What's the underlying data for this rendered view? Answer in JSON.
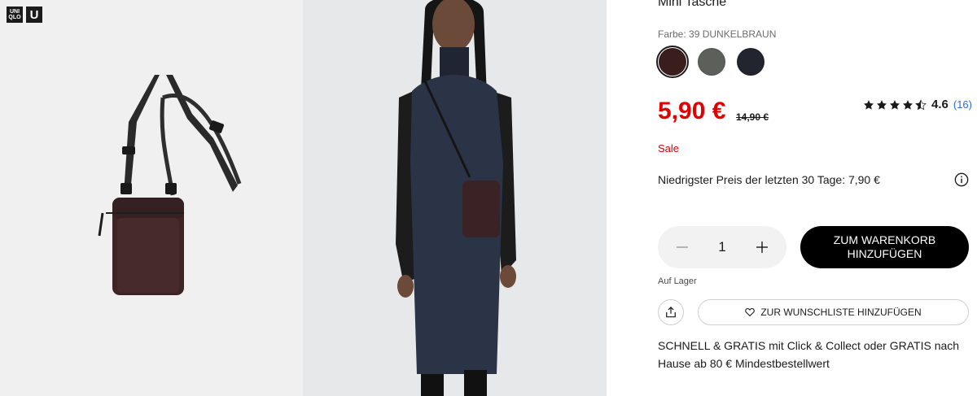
{
  "logo": {
    "uniqlo_lines": [
      "UNI",
      "QLO"
    ],
    "u": "U"
  },
  "product": {
    "title": "Mini Tasche",
    "color_label": "Farbe: 39 DUNKELBRAUN",
    "swatches": [
      {
        "name": "DUNKELBRAUN",
        "color": "#3a1e1d",
        "selected": true
      },
      {
        "name": "OLIVE",
        "color": "#5c5f5a",
        "selected": false
      },
      {
        "name": "NAVY",
        "color": "#22252d",
        "selected": false
      }
    ],
    "price": "5,90 €",
    "old_price": "14,90 €",
    "price_color": "#e00000",
    "rating": {
      "value": "4.6",
      "count": "(16)",
      "stars": 4.5
    },
    "sale_label": "Sale",
    "lowest_price": "Niedrigster Preis der letzten 30 Tage: 7,90 €",
    "quantity": "1",
    "add_to_cart": "ZUM WARENKORB HINZUFÜGEN",
    "stock": "Auf Lager",
    "wishlist": "ZUR WUNSCHLISTE HINZUFÜGEN",
    "shipping": "SCHNELL & GRATIS mit Click & Collect oder GRATIS nach Hause ab 80 € Mindestbestellwert"
  }
}
